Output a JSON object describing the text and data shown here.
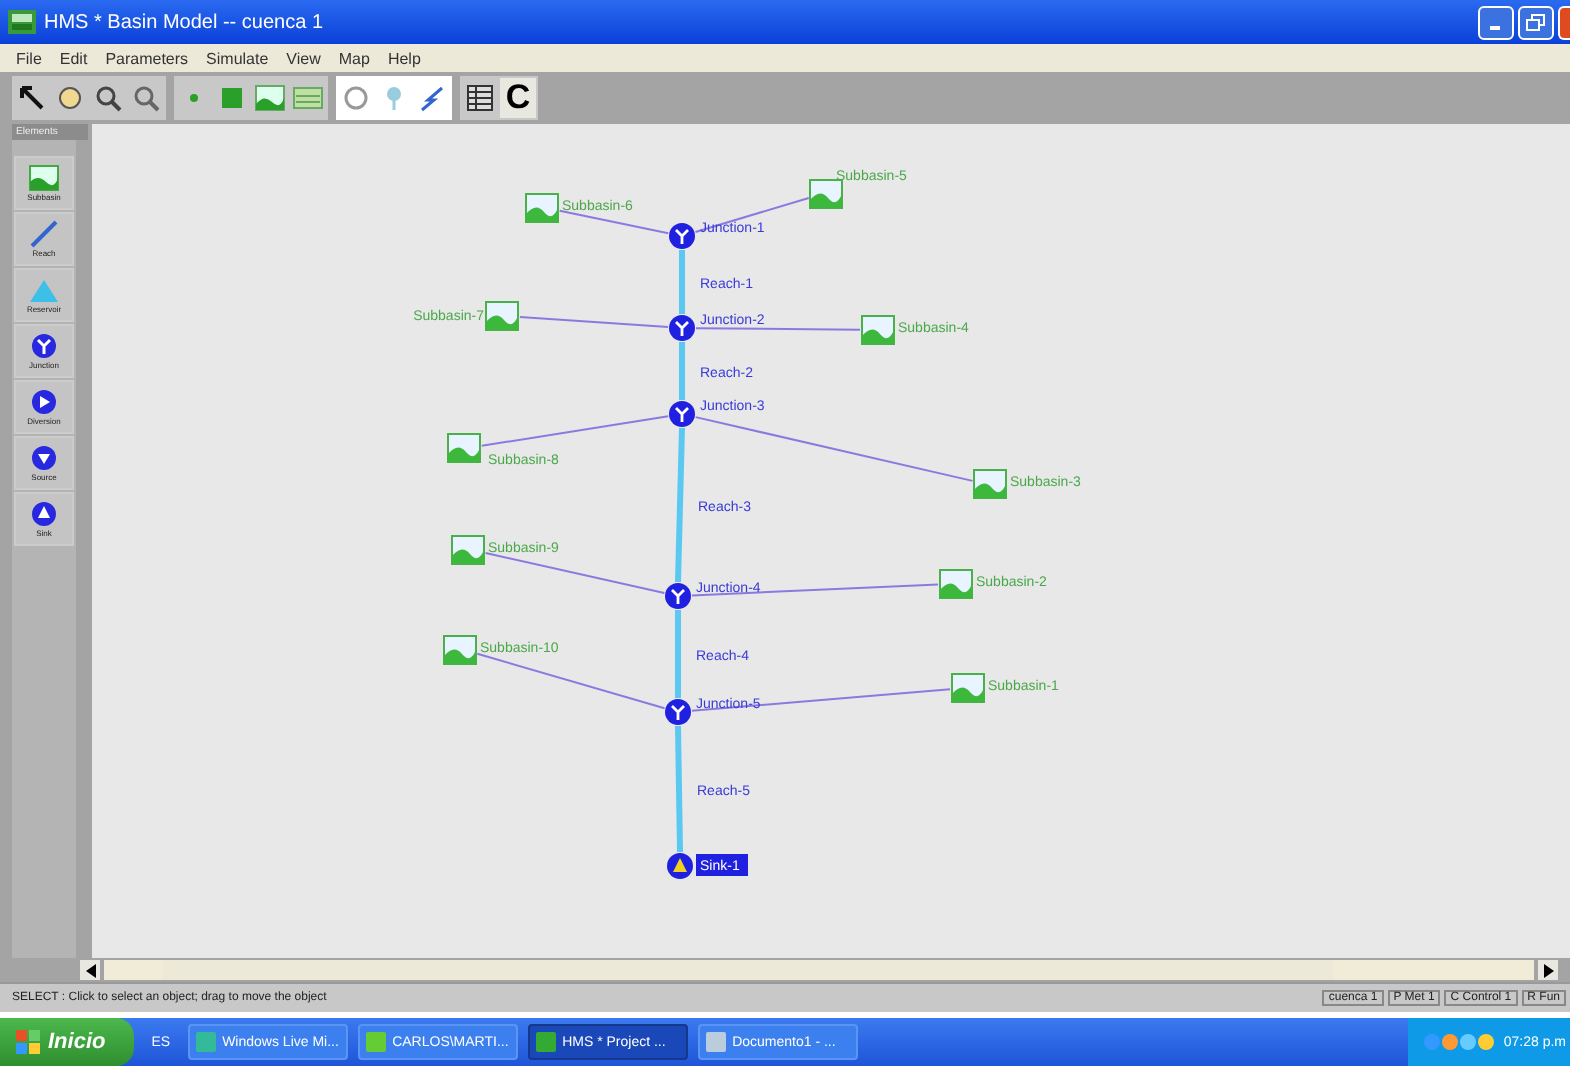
{
  "window": {
    "title": "HMS * Basin Model -- cuenca 1"
  },
  "menu": [
    "File",
    "Edit",
    "Parameters",
    "Simulate",
    "View",
    "Map",
    "Help"
  ],
  "toolbar": {
    "text_button": "C"
  },
  "palette": {
    "title": "Elements",
    "items": [
      {
        "label": "Subbasin",
        "kind": "subbasin"
      },
      {
        "label": "Reach",
        "kind": "reach"
      },
      {
        "label": "Reservoir",
        "kind": "reservoir"
      },
      {
        "label": "Junction",
        "kind": "junction"
      },
      {
        "label": "Diversion",
        "kind": "diversion"
      },
      {
        "label": "Source",
        "kind": "source"
      },
      {
        "label": "Sink",
        "kind": "sink"
      }
    ]
  },
  "diagram": {
    "junctions": [
      {
        "label": "Junction-1",
        "reach": "Reach-1",
        "subbasins": [
          {
            "label": "Subbasin-6"
          },
          {
            "label": "Subbasin-5"
          }
        ]
      },
      {
        "label": "Junction-2",
        "reach": "Reach-2",
        "subbasins": [
          {
            "label": "Subbasin-7"
          },
          {
            "label": "Subbasin-4"
          }
        ]
      },
      {
        "label": "Junction-3",
        "reach": "Reach-3",
        "subbasins": [
          {
            "label": "Subbasin-8"
          },
          {
            "label": "Subbasin-3"
          }
        ]
      },
      {
        "label": "Junction-4",
        "reach": "Reach-4",
        "subbasins": [
          {
            "label": "Subbasin-9"
          },
          {
            "label": "Subbasin-2"
          }
        ]
      },
      {
        "label": "Junction-5",
        "reach": "Reach-5",
        "subbasins": [
          {
            "label": "Subbasin-10"
          },
          {
            "label": "Subbasin-1"
          }
        ]
      }
    ],
    "sink": {
      "label": "Sink-1",
      "selected": true
    }
  },
  "status_bar": {
    "message": "SELECT : Click to select an object; drag to move the object",
    "panes": [
      "cuenca 1",
      "P Met 1",
      "C Control 1",
      "R Fun"
    ]
  },
  "taskbar": {
    "start": "Inicio",
    "quick": "ES",
    "buttons": [
      {
        "label": "Windows Live Mi...",
        "selected": false
      },
      {
        "label": "CARLOS\\MARTI...",
        "selected": false
      },
      {
        "label": "HMS * Project ...",
        "selected": true
      },
      {
        "label": "Documento1 - ...",
        "selected": false
      }
    ],
    "clock": "07:28 p.m"
  }
}
